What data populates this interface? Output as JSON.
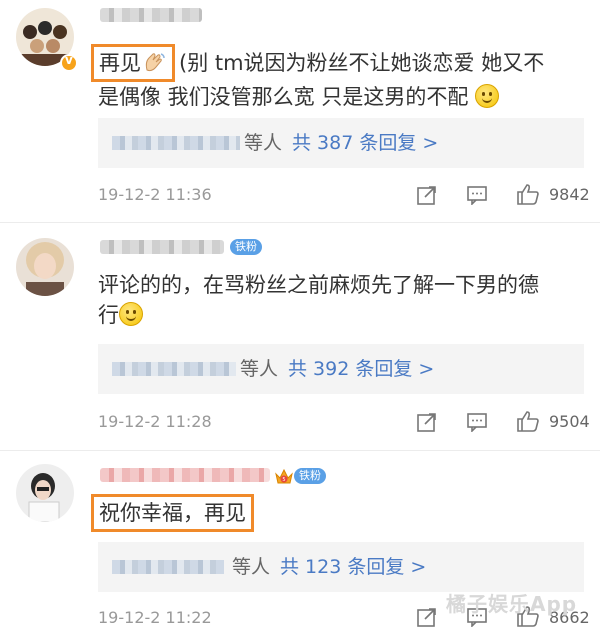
{
  "comments": [
    {
      "text_highlight": "再见",
      "text_line1": "(别 tm说因为粉丝不让她谈恋爱 她又不",
      "text_line2": "是偶像 我们没管那么宽 只是这男的不配",
      "reply_who": "等人",
      "reply_count": "共 387 条回复 >",
      "time": "19-12-2 11:36",
      "likes": "9842"
    },
    {
      "badge": "铁粉",
      "text_line1": "评论的的，在骂粉丝之前麻烦先了解一下男的德",
      "text_line2": "行",
      "reply_who": "等人",
      "reply_count": "共 392 条回复 >",
      "time": "19-12-2 11:28",
      "likes": "9504"
    },
    {
      "badge_level": "5",
      "badge": "铁粉",
      "text_highlight": "祝你幸福，再见",
      "reply_who": "等人",
      "reply_count": "共 123 条回复 >",
      "time": "19-12-2 11:22",
      "likes": "8662"
    }
  ],
  "watermark": "橘子娱乐App",
  "icons": {
    "share": "share-icon",
    "comment": "comment-icon",
    "like": "thumbs-up-icon"
  },
  "colors": {
    "highlight_border": "#f08a2a",
    "reply_count": "#4a7ac4",
    "fan_badge": "#5aa0e6"
  }
}
